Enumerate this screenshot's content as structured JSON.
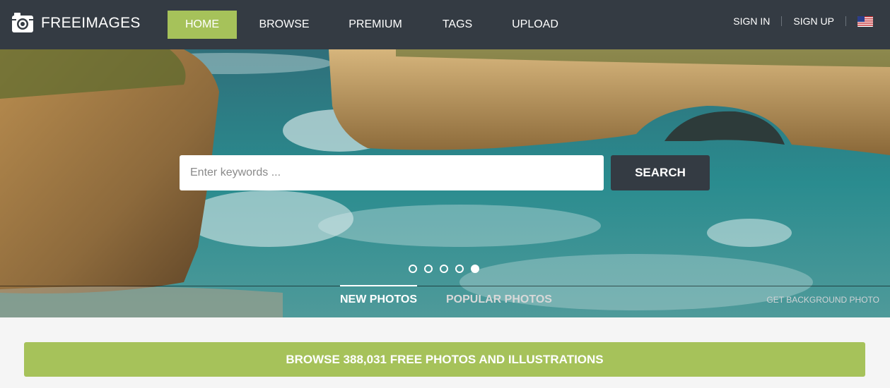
{
  "brand": {
    "name": "FREEIMAGES"
  },
  "nav": [
    {
      "label": "HOME",
      "active": true
    },
    {
      "label": "BROWSE",
      "active": false
    },
    {
      "label": "PREMIUM",
      "active": false
    },
    {
      "label": "TAGS",
      "active": false
    },
    {
      "label": "UPLOAD",
      "active": false
    }
  ],
  "auth": {
    "sign_in": "SIGN IN",
    "sign_up": "SIGN UP",
    "language_icon": "us-flag-icon"
  },
  "search": {
    "placeholder": "Enter keywords ...",
    "button": "SEARCH"
  },
  "slider": {
    "count": 5,
    "active_index": 4
  },
  "tabs": {
    "new": "NEW PHOTOS",
    "popular": "POPULAR PHOTOS"
  },
  "get_background": "GET BACKGROUND PHOTO",
  "browse_banner": "BROWSE 388,031 FREE PHOTOS AND ILLUSTRATIONS",
  "colors": {
    "header": "#343b43",
    "accent": "#a6c25a"
  }
}
